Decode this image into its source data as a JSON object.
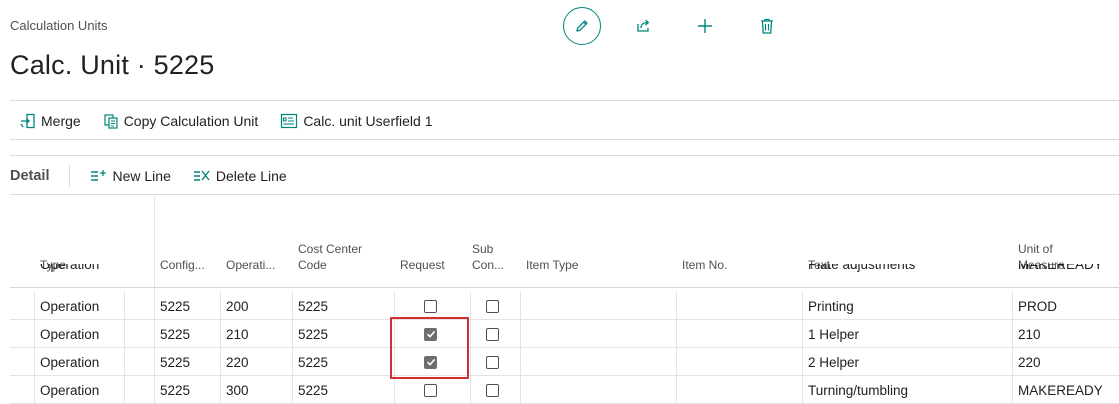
{
  "breadcrumb": "Calculation Units",
  "title": "Calc. Unit · 5225",
  "top_actions": {
    "edit_icon": "pencil-icon",
    "share_icon": "share-icon",
    "new_icon": "plus-icon",
    "delete_icon": "trash-icon"
  },
  "actions": [
    {
      "label": "Merge",
      "icon": "merge-icon"
    },
    {
      "label": "Copy Calculation Unit",
      "icon": "copy-icon"
    },
    {
      "label": "Calc. unit Userfield 1",
      "icon": "userfield-icon"
    }
  ],
  "detail": {
    "title": "Detail",
    "new_line": "New Line",
    "delete_line": "Delete Line"
  },
  "columns": {
    "type": "Type",
    "config": "Config...",
    "operation": "Operati...",
    "cost_center_1": "Cost Center",
    "cost_center_2": "Code",
    "request": "Request",
    "sub_con_1": "Sub",
    "sub_con_2": "Con...",
    "item_type": "Item Type",
    "item_no": "Item No.",
    "text": "Text",
    "unit_1": "Unit of",
    "unit_2": "Measure"
  },
  "partial_row": {
    "type": "Operation",
    "text": "Plate adjustments",
    "unit": "MAKEREADY"
  },
  "rows": [
    {
      "type": "Operation",
      "config": "5225",
      "operation": "200",
      "cost_center": "5225",
      "request": false,
      "sub_con": false,
      "item_type": "",
      "item_no": "",
      "text": "Printing",
      "unit": "PROD"
    },
    {
      "type": "Operation",
      "config": "5225",
      "operation": "210",
      "cost_center": "5225",
      "request": true,
      "sub_con": false,
      "item_type": "",
      "item_no": "",
      "text": "1 Helper",
      "unit": "210"
    },
    {
      "type": "Operation",
      "config": "5225",
      "operation": "220",
      "cost_center": "5225",
      "request": true,
      "sub_con": false,
      "item_type": "",
      "item_no": "",
      "text": "2 Helper",
      "unit": "220"
    },
    {
      "type": "Operation",
      "config": "5225",
      "operation": "300",
      "cost_center": "5225",
      "request": false,
      "sub_con": false,
      "item_type": "",
      "item_no": "",
      "text": "Turning/tumbling",
      "unit": "MAKEREADY"
    }
  ],
  "colors": {
    "accent": "#00857d",
    "highlight": "#d32f2f"
  }
}
